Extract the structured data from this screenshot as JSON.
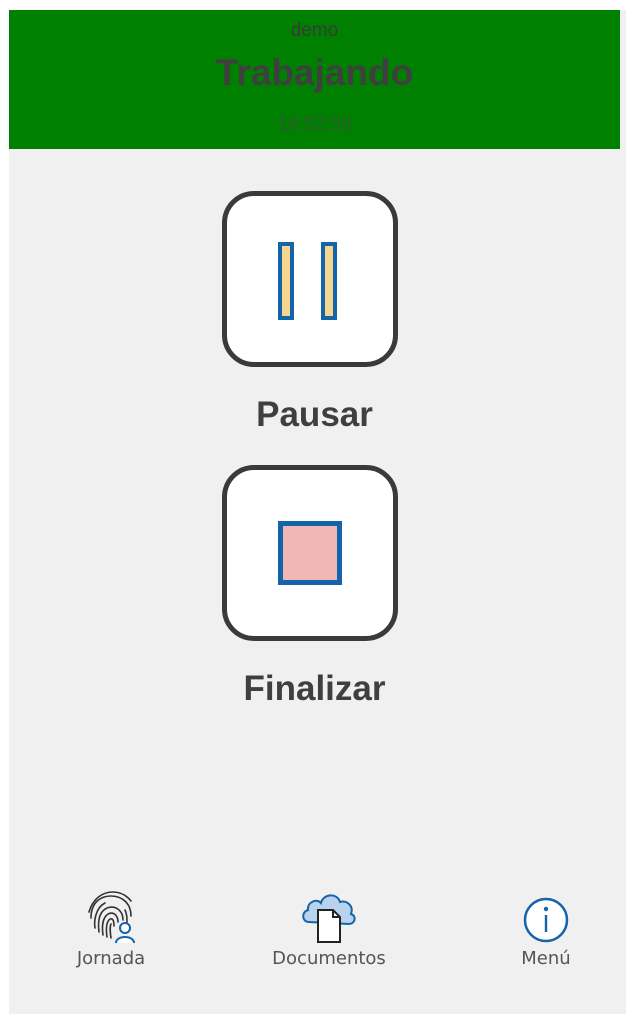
{
  "header": {
    "user": "demo",
    "status": "Trabajando",
    "clock": "18:52:58",
    "background_color": "#008000"
  },
  "actions": [
    {
      "id": "pause",
      "label": "Pausar",
      "icon": "pause-icon"
    },
    {
      "id": "finish",
      "label": "Finalizar",
      "icon": "stop-icon"
    }
  ],
  "navbar": {
    "items": [
      {
        "label": "Jornada",
        "icon": "fingerprint-user-icon"
      },
      {
        "label": "Documentos",
        "icon": "cloud-document-icon"
      },
      {
        "label": "Menú",
        "icon": "info-icon"
      }
    ]
  },
  "colors": {
    "accent": "#1464aa",
    "pause_fill": "#f5d590",
    "stop_fill": "#f1b7b7",
    "button_border": "#3a3a3a"
  }
}
